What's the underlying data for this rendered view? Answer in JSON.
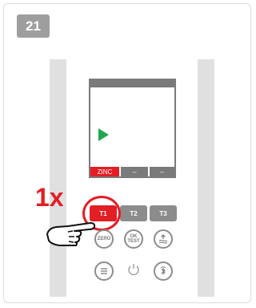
{
  "step_number": "21",
  "press_count": "1x",
  "display": {
    "segments": [
      "ZINC",
      "--",
      "--"
    ]
  },
  "keys": {
    "t1": "T1",
    "t2": "T2",
    "t3": "T3",
    "zero": "ZERO",
    "ok_test_line1": "OK",
    "ok_test_line2": "TEST"
  },
  "colors": {
    "accent": "#e31e24",
    "play": "#1fa84f",
    "grey": "#8c8c8c"
  }
}
